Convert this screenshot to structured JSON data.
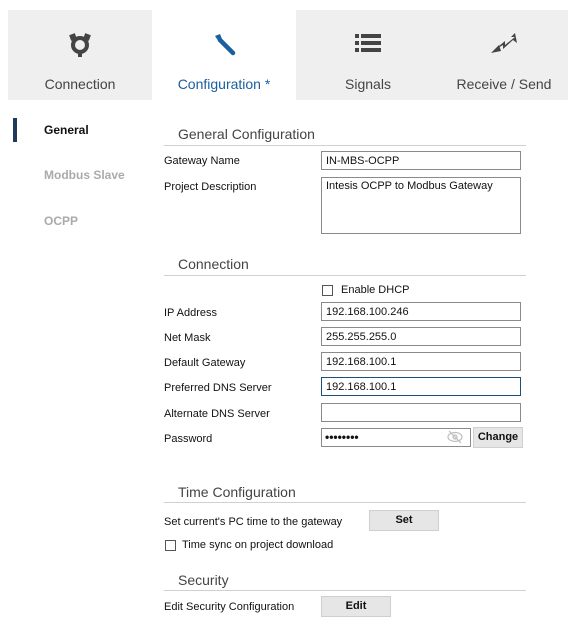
{
  "tabs": [
    {
      "label": "Connection",
      "icon": "connection-plug-icon",
      "active": false
    },
    {
      "label": "Configuration *",
      "icon": "wrench-icon",
      "active": true
    },
    {
      "label": "Signals",
      "icon": "list-icon",
      "active": false
    },
    {
      "label": "Receive / Send",
      "icon": "transfer-arrows-icon",
      "active": false
    }
  ],
  "nav": [
    {
      "label": "General",
      "active": true
    },
    {
      "label": "Modbus Slave",
      "active": false
    },
    {
      "label": "OCPP",
      "active": false
    }
  ],
  "general": {
    "title": "General Configuration",
    "gateway_name_label": "Gateway Name",
    "gateway_name_value": "IN-MBS-OCPP",
    "project_description_label": "Project Description",
    "project_description_value": "Intesis OCPP to Modbus Gateway"
  },
  "connection": {
    "title": "Connection",
    "dhcp_label": "Enable DHCP",
    "dhcp_checked": false,
    "ip_label": "IP Address",
    "ip_value": "192.168.100.246",
    "mask_label": "Net Mask",
    "mask_value": "255.255.255.0",
    "gateway_label": "Default Gateway",
    "gateway_value": "192.168.100.1",
    "preferred_dns_label": "Preferred DNS Server",
    "preferred_dns_value": "192.168.100.1",
    "alternate_dns_label": "Alternate DNS Server",
    "alternate_dns_value": "",
    "password_label": "Password",
    "password_mask": "••••••••",
    "change_button": "Change"
  },
  "time": {
    "title": "Time Configuration",
    "set_pc_time_label": "Set current's PC time to the gateway",
    "set_button": "Set",
    "sync_label": "Time sync on project download",
    "sync_checked": false
  },
  "security": {
    "title": "Security",
    "edit_label": "Edit Security Configuration",
    "edit_button": "Edit"
  },
  "colors": {
    "active_tab_text": "#1a5fa0",
    "nav_indicator": "#1f3a5a",
    "inactive_tab_bg": "#efefef"
  }
}
